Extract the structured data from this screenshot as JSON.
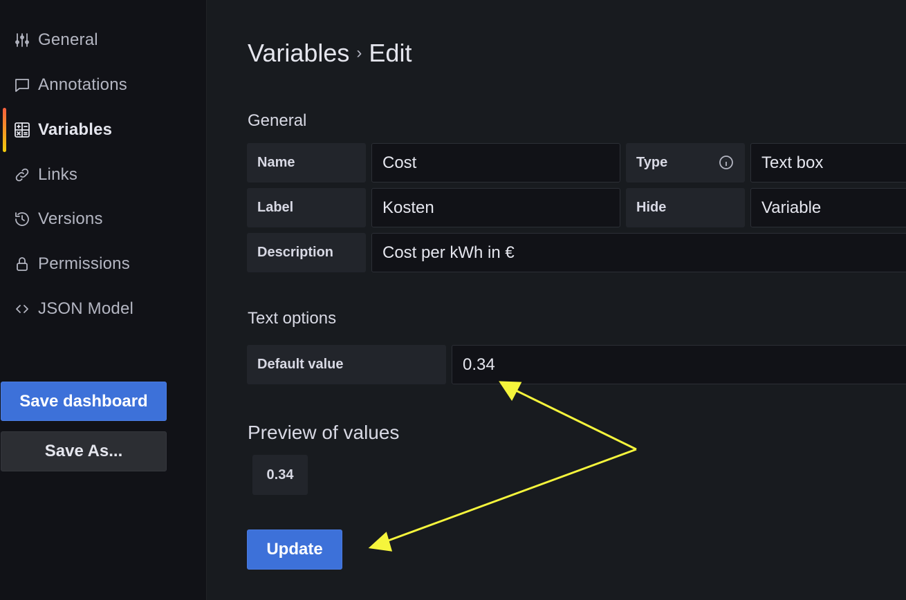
{
  "sidebar": {
    "items": [
      {
        "label": "General",
        "icon": "sliders-icon",
        "active": false
      },
      {
        "label": "Annotations",
        "icon": "comment-icon",
        "active": false
      },
      {
        "label": "Variables",
        "icon": "calculator-icon",
        "active": true
      },
      {
        "label": "Links",
        "icon": "link-icon",
        "active": false
      },
      {
        "label": "Versions",
        "icon": "history-icon",
        "active": false
      },
      {
        "label": "Permissions",
        "icon": "lock-icon",
        "active": false
      },
      {
        "label": "JSON Model",
        "icon": "code-icon",
        "active": false
      }
    ],
    "save_label": "Save dashboard",
    "save_as_label": "Save As..."
  },
  "header": {
    "breadcrumb_parent": "Variables",
    "breadcrumb_separator": "›",
    "breadcrumb_current": "Edit"
  },
  "general": {
    "title": "General",
    "name_label": "Name",
    "name_value": "Cost",
    "type_label": "Type",
    "type_value": "Text box",
    "label_label": "Label",
    "label_value": "Kosten",
    "hide_label": "Hide",
    "hide_value": "Variable",
    "description_label": "Description",
    "description_value": "Cost per kWh in €"
  },
  "text_options": {
    "title": "Text options",
    "default_value_label": "Default value",
    "default_value": "0.34"
  },
  "preview": {
    "title": "Preview of values",
    "values": [
      "0.34"
    ]
  },
  "actions": {
    "update_label": "Update"
  },
  "colors": {
    "primary": "#3d71d9",
    "annotation_arrow": "#f5f53c",
    "active_gradient_top": "#f55f3e",
    "active_gradient_bottom": "#f2cc0c"
  }
}
